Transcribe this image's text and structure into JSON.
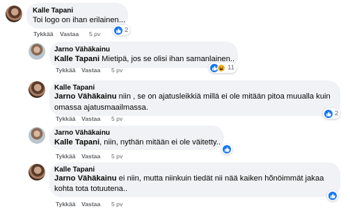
{
  "comments": [
    {
      "author": "Kalle Tapani",
      "mention": "",
      "text": "Toi logo on ihan erilainen...",
      "text2": "",
      "like_label": "Tykkää",
      "reply_label": "Vastaa",
      "time": "5 pv",
      "reaction_count": "2",
      "reactions": [
        "like-icon"
      ]
    },
    {
      "author": "Jarno Vähäkainu",
      "mention": "Kalle Tapani",
      "text": " Mietipä, jos se olisi ihan samanlainen..",
      "text2": "",
      "like_label": "Tykkää",
      "reply_label": "Vastaa",
      "time": "5 pv",
      "reaction_count": "11",
      "reactions": [
        "like-icon",
        "haha-icon"
      ]
    },
    {
      "author": "Kalle Tapani",
      "mention": "Jarno Vähäkainu",
      "text": " niin , se on ajatusleikkiä millä ei ole mitään pitoa muualla kuin",
      "text2": "omassa ajatusmaailmassa.",
      "like_label": "Tykkää",
      "reply_label": "Vastaa",
      "time": "5 pv",
      "reaction_count": "2",
      "reactions": [
        "like-icon"
      ]
    },
    {
      "author": "Jarno Vähäkainu",
      "mention": "Kalle Tapani",
      "text": ", niin, nythän mitään ei ole väitetty..",
      "text2": "",
      "like_label": "Tykkää",
      "reply_label": "Vastaa",
      "time": "5 pv",
      "reaction_count": "",
      "reactions": [
        "like-icon"
      ]
    },
    {
      "author": "Kalle Tapani",
      "mention": "Jarno Vähäkainu",
      "text": " ei niin, mutta niinkuin tiedät nii nää kaiken hõnöimmät jakaa",
      "text2": "kohta tota totuutena..",
      "like_label": "Tykkää",
      "reply_label": "Vastaa",
      "time": "5 pv",
      "reaction_count": "",
      "reactions": [
        "like-icon"
      ]
    }
  ],
  "colors": {
    "bubble": "#f0f2f5",
    "like_blue": "#1877f2",
    "meta_gray": "#65676b",
    "haha_yellow": "#f7b125"
  }
}
